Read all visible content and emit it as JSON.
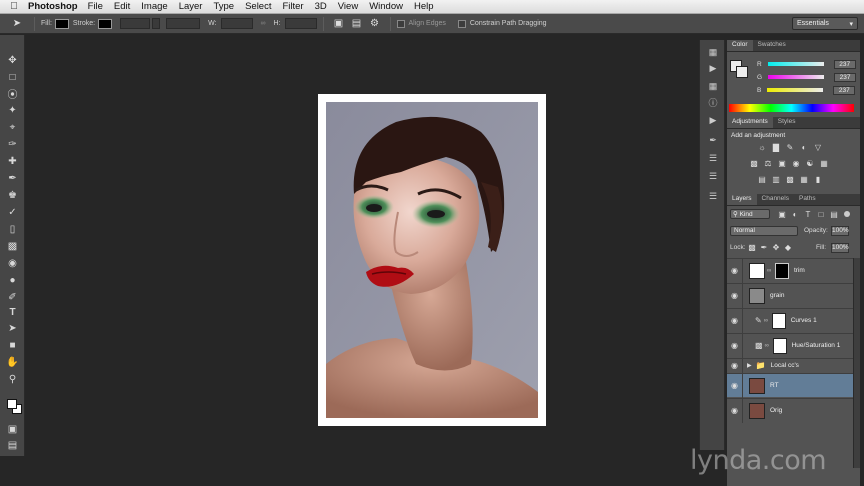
{
  "menubar": {
    "app": "Photoshop",
    "items": [
      "File",
      "Edit",
      "Image",
      "Layer",
      "Type",
      "Select",
      "Filter",
      "3D",
      "View",
      "Window",
      "Help"
    ]
  },
  "options": {
    "fill_label": "Fill:",
    "stroke_label": "Stroke:",
    "w_label": "W:",
    "h_label": "H:",
    "align_edges": "Align Edges",
    "constrain": "Constrain Path Dragging",
    "workspace": "Essentials"
  },
  "color_panel": {
    "tabs": [
      "Color",
      "Swatches"
    ],
    "r_label": "R",
    "g_label": "G",
    "b_label": "B",
    "r": "237",
    "g": "237",
    "b": "237"
  },
  "adjustments_panel": {
    "tabs": [
      "Adjustments",
      "Styles"
    ],
    "heading": "Add an adjustment"
  },
  "layers_panel": {
    "tabs": [
      "Layers",
      "Channels",
      "Paths"
    ],
    "filter": "Kind",
    "blend_mode": "Normal",
    "opacity_label": "Opacity:",
    "opacity": "100%",
    "lock_label": "Lock:",
    "fill_label": "Fill:",
    "fill": "100%",
    "layers": [
      {
        "name": "trim"
      },
      {
        "name": "grain"
      },
      {
        "name": "Curves 1"
      },
      {
        "name": "Hue/Saturation 1"
      },
      {
        "name": "Local cc's"
      },
      {
        "name": "RT"
      },
      {
        "name": "Orig"
      }
    ]
  },
  "watermark": "lynda.com",
  "colors": {
    "selected_layer": "#627d97",
    "panel_bg": "#535353",
    "workspace_bg": "#262626"
  }
}
